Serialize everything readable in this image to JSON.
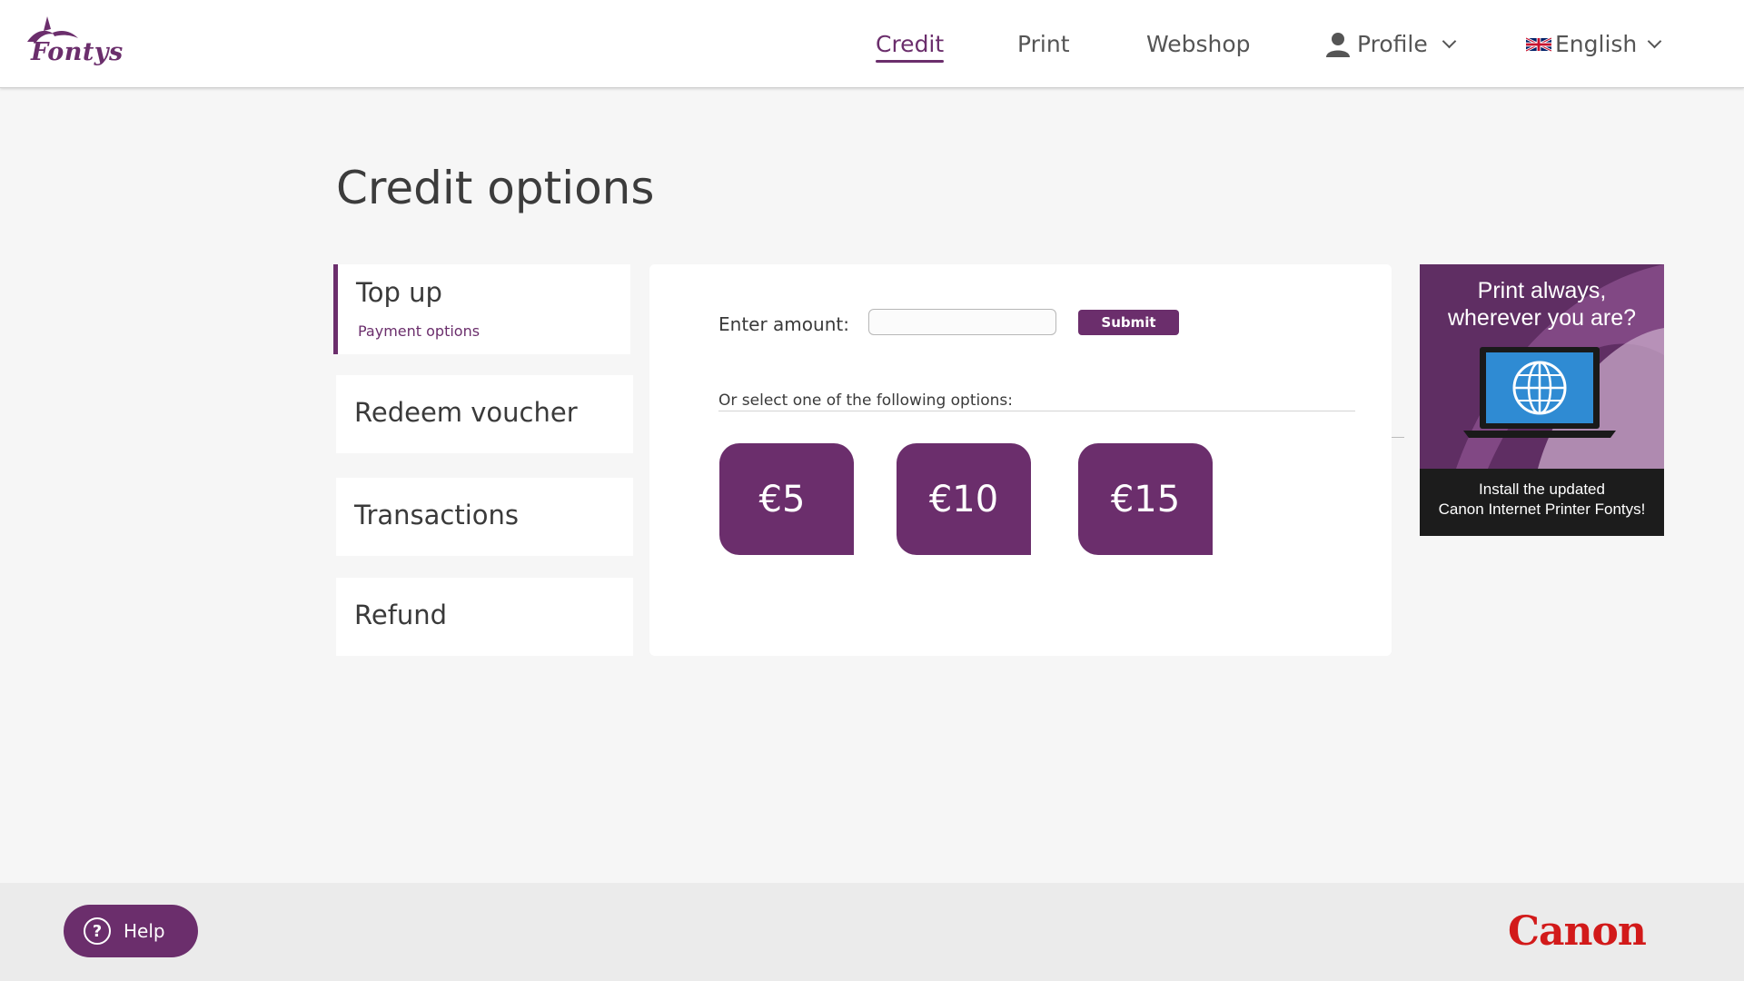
{
  "brand": {
    "logo_text": "Fontys",
    "logo_color": "#6b2e6c"
  },
  "nav": {
    "credit": "Credit",
    "print": "Print",
    "webshop": "Webshop",
    "profile": "Profile",
    "language": "English",
    "active": "Credit"
  },
  "page": {
    "title": "Credit options"
  },
  "sidebar": {
    "items": [
      {
        "label": "Top up",
        "sublabel": "Payment options",
        "active": true
      },
      {
        "label": "Redeem voucher"
      },
      {
        "label": "Transactions"
      },
      {
        "label": "Refund"
      }
    ]
  },
  "topup": {
    "amount_label": "Enter amount:",
    "amount_value": "",
    "submit_label": "Submit",
    "or_label": "Or select one of the following options:",
    "options": [
      "€5",
      "€10",
      "€15"
    ]
  },
  "ad": {
    "headline_line1": "Print always,",
    "headline_line2": "wherever you are?",
    "footer_line1": "Install the updated",
    "footer_line2": "Canon Internet Printer Fontys!"
  },
  "footer": {
    "help_label": "Help",
    "canon_logo": "Canon"
  },
  "colors": {
    "accent": "#6b2e6c",
    "canon_red": "#d21a1a"
  }
}
